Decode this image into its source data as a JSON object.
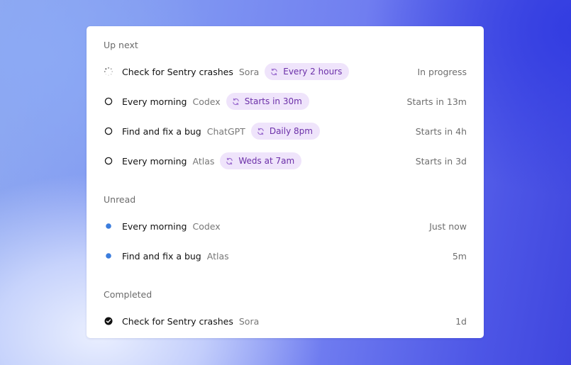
{
  "sections": {
    "up_next": {
      "title": "Up next",
      "rows": [
        {
          "title": "Check for Sentry crashes",
          "app": "Sora",
          "schedule": "Every 2 hours",
          "when": "In progress",
          "status": "in-progress"
        },
        {
          "title": "Every morning",
          "app": "Codex",
          "schedule": "Starts in 30m",
          "when": "Starts in 13m",
          "status": "pending"
        },
        {
          "title": "Find and fix a bug",
          "app": "ChatGPT",
          "schedule": "Daily 8pm",
          "when": "Starts in 4h",
          "status": "pending"
        },
        {
          "title": "Every morning",
          "app": "Atlas",
          "schedule": "Weds at 7am",
          "when": "Starts in 3d",
          "status": "pending"
        }
      ]
    },
    "unread": {
      "title": "Unread",
      "rows": [
        {
          "title": "Every morning",
          "app": "Codex",
          "when": "Just now",
          "status": "unread"
        },
        {
          "title": "Find and fix a bug",
          "app": "Atlas",
          "when": "5m",
          "status": "unread"
        }
      ]
    },
    "completed": {
      "title": "Completed",
      "rows": [
        {
          "title": "Check for Sentry crashes",
          "app": "Sora",
          "when": "1d",
          "status": "completed"
        }
      ]
    }
  },
  "icons": {
    "in_progress": "spinner-icon",
    "pending": "empty-circle-icon",
    "unread": "unread-dot-icon",
    "completed": "check-circle-icon",
    "schedule": "repeat-icon"
  },
  "colors": {
    "chip_background": "#efe4fb",
    "chip_text": "#6b2fa8",
    "unread_dot": "#3b7ddd",
    "primary_text": "#111111",
    "secondary_text": "#777777"
  }
}
